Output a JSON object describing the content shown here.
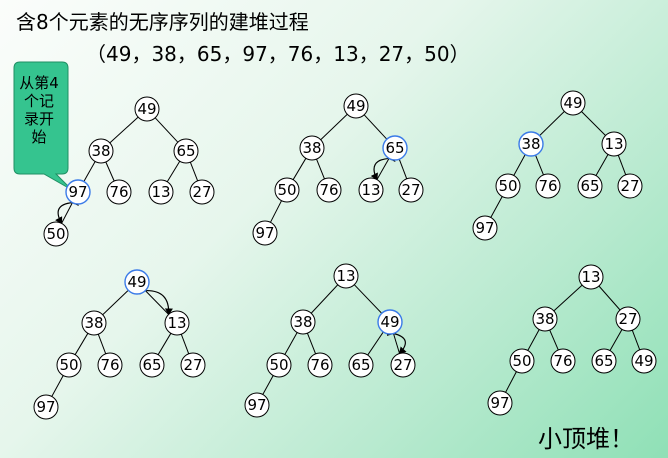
{
  "title": "含8个元素的无序序列的建堆过程",
  "sequence": "（49，38，65，97，76，13，27，50）",
  "callout": "从第4个记录开始",
  "conclusion": "小顶堆！",
  "colors": {
    "node_border": "#000000",
    "node_fill": "#ffffff",
    "highlight_border": "#3b7be8",
    "callout_fill": "#35c48f",
    "background_accent": "#8fe0b6"
  },
  "trees": [
    {
      "nodes": [
        "49",
        "38",
        "65",
        "97",
        "76",
        "13",
        "27",
        "50"
      ],
      "highlight": 3,
      "swap": [
        3,
        7
      ]
    },
    {
      "nodes": [
        "49",
        "38",
        "65",
        "50",
        "76",
        "13",
        "27",
        "97"
      ],
      "highlight": 2,
      "swap": [
        2,
        5
      ]
    },
    {
      "nodes": [
        "49",
        "38",
        "13",
        "50",
        "76",
        "65",
        "27",
        "97"
      ],
      "highlight": 1,
      "swap": null
    },
    {
      "nodes": [
        "49",
        "38",
        "13",
        "50",
        "76",
        "65",
        "27",
        "97"
      ],
      "highlight": 0,
      "swap": [
        0,
        2
      ]
    },
    {
      "nodes": [
        "13",
        "38",
        "49",
        "50",
        "76",
        "65",
        "27",
        "97"
      ],
      "highlight": 2,
      "swap": [
        2,
        6
      ]
    },
    {
      "nodes": [
        "13",
        "38",
        "27",
        "50",
        "76",
        "65",
        "49",
        "97"
      ],
      "highlight": null,
      "swap": null
    }
  ]
}
